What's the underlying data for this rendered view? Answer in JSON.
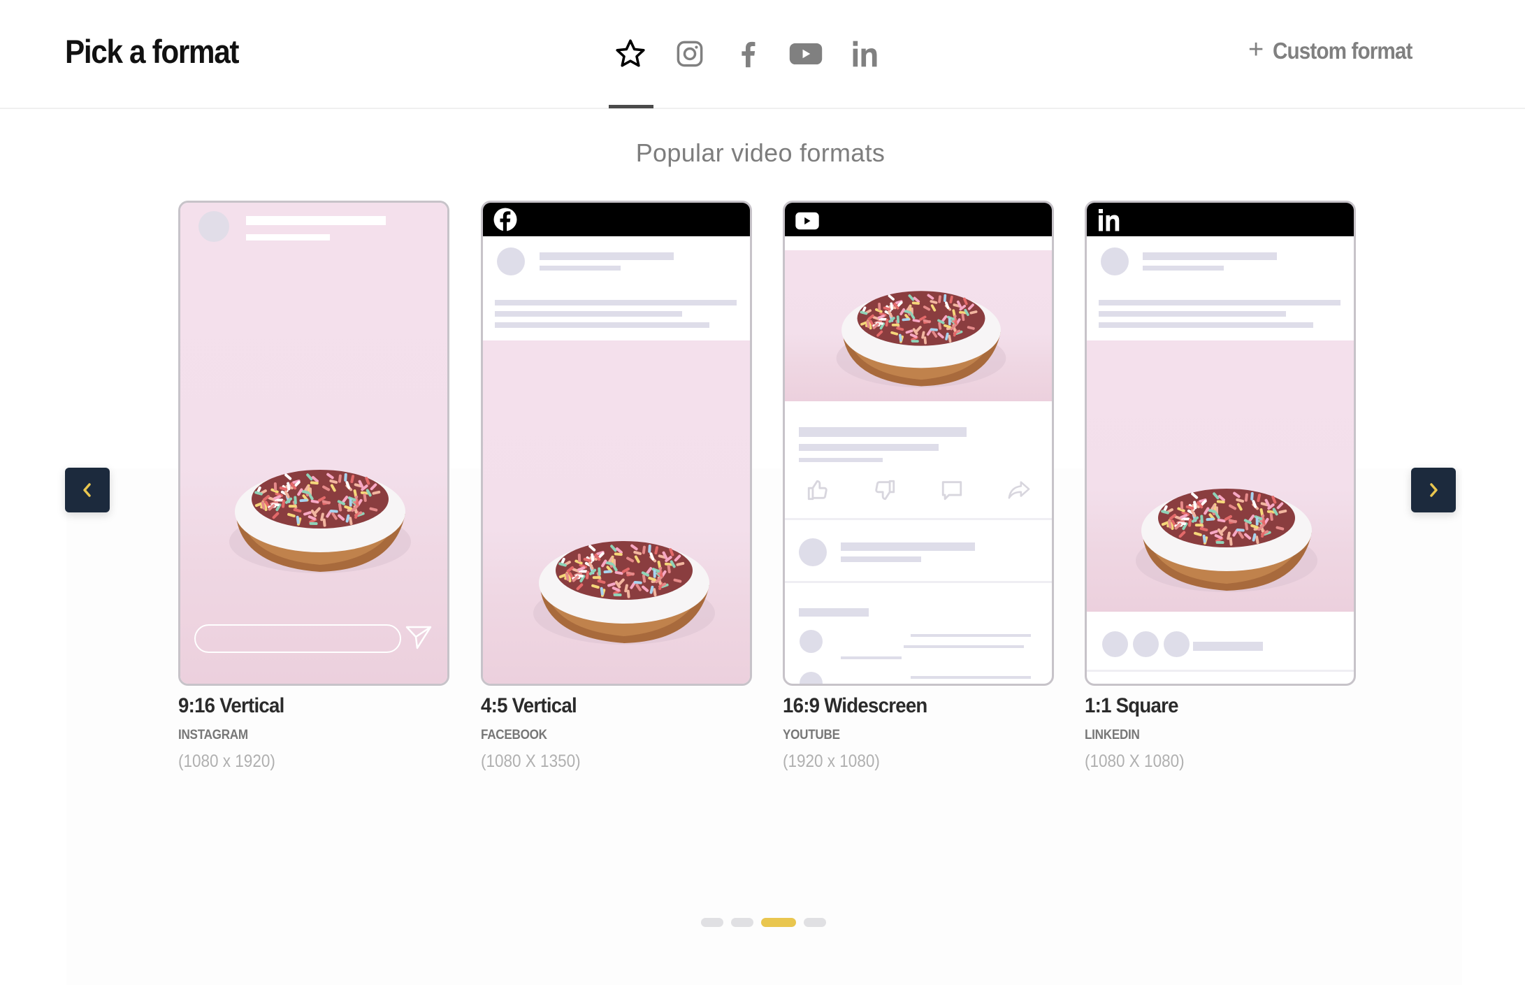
{
  "header": {
    "title": "Pick a format",
    "tabs": [
      {
        "id": "popular",
        "icon": "star-icon",
        "active": true
      },
      {
        "id": "instagram",
        "icon": "instagram-icon",
        "active": false
      },
      {
        "id": "facebook",
        "icon": "facebook-icon",
        "active": false
      },
      {
        "id": "youtube",
        "icon": "youtube-icon",
        "active": false
      },
      {
        "id": "linkedin",
        "icon": "linkedin-icon",
        "active": false
      }
    ],
    "custom_format_label": "Custom format",
    "custom_format_icon": "plus-icon"
  },
  "main": {
    "subtitle": "Popular video formats",
    "cards": [
      {
        "title": "9:16 Vertical",
        "platform": "INSTAGRAM",
        "dimensions": "(1080 x 1920)",
        "icon": "instagram-story"
      },
      {
        "title": "4:5 Vertical",
        "platform": "FACEBOOK",
        "dimensions": "(1080 X 1350)",
        "icon": "facebook-icon"
      },
      {
        "title": "16:9 Widescreen",
        "platform": "YOUTUBE",
        "dimensions": "(1920 x 1080)",
        "icon": "youtube-icon"
      },
      {
        "title": "1:1 Square",
        "platform": "LINKEDIN",
        "dimensions": "(1080 X 1080)",
        "icon": "linkedin-icon"
      }
    ],
    "prev_icon": "chevron-left-icon",
    "next_icon": "chevron-right-icon",
    "pagination": {
      "total": 4,
      "active_index": 2
    }
  },
  "colors": {
    "accent": "#e9c64f",
    "nav_button_bg": "#1c2a3d",
    "dot_inactive": "#e0e0e3",
    "icon_gray": "#808080",
    "skeleton": "#dedde9"
  }
}
